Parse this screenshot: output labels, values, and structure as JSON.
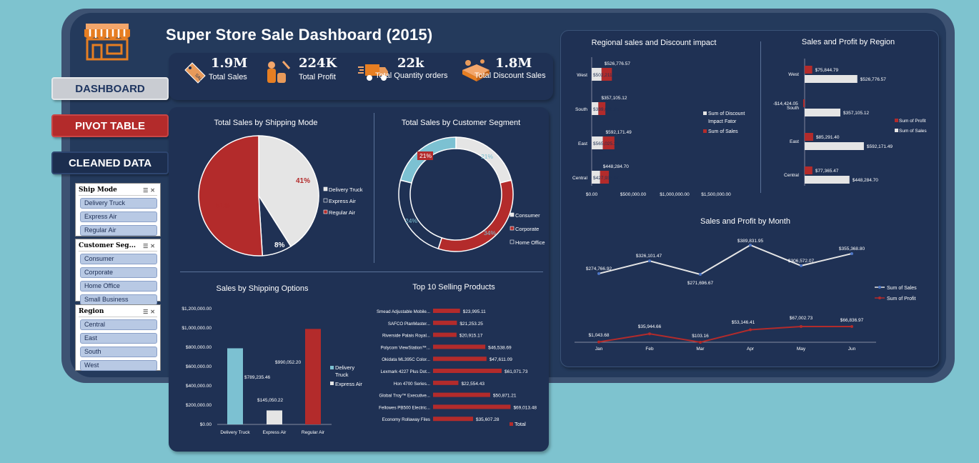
{
  "header": {
    "title": "Super Store Sale Dashboard (2015)"
  },
  "nav": {
    "dashboard": "DASHBOARD",
    "pivot": "PIVOT TABLE",
    "cleaned": "CLEANED DATA"
  },
  "kpis": [
    {
      "value": "1.9M",
      "label": "Total Sales",
      "icon": "sale-tag-icon"
    },
    {
      "value": "224K",
      "label": "Total Profit",
      "icon": "coins-icon"
    },
    {
      "value": "22k",
      "label": "Total Quantity orders",
      "icon": "truck-icon"
    },
    {
      "value": "1.8M",
      "label": "Total Discount Sales",
      "icon": "discount-box-icon"
    }
  ],
  "slicers": [
    {
      "title": "Ship Mode",
      "items": [
        "Delivery Truck",
        "Express Air",
        "Regular Air"
      ]
    },
    {
      "title": "Customer Seg...",
      "items": [
        "Consumer",
        "Corporate",
        "Home Office",
        "Small Business"
      ]
    },
    {
      "title": "Region",
      "items": [
        "Central",
        "East",
        "South",
        "West"
      ]
    }
  ],
  "colors": {
    "red": "#b32b2b",
    "grey": "#e5e5e5",
    "teal": "#7cc1d2",
    "navy": "#1f3154"
  },
  "chart_data": [
    {
      "id": "shipping_mode",
      "type": "pie",
      "title": "Total Sales by Shipping Mode",
      "categories": [
        "Delivery Truck",
        "Express Air",
        "Regular Air"
      ],
      "values": [
        41,
        8,
        51
      ],
      "labels": [
        "41%",
        "8%",
        "51%"
      ],
      "colors": [
        "#e5e5e5",
        "#1f3154",
        "#b32b2b"
      ]
    },
    {
      "id": "customer_segment",
      "type": "pie",
      "title": "Total Sales by Customer Segment",
      "categories": [
        "Consumer",
        "Corporate",
        "Home Office",
        "Small Business"
      ],
      "values": [
        21,
        34,
        24,
        21
      ],
      "labels": [
        "21%",
        "34%",
        "24%",
        "21%"
      ],
      "colors": [
        "#e5e5e5",
        "#b32b2b",
        "#1f3154",
        "#7cc1d2"
      ],
      "legend": [
        "Consumer",
        "Corporate",
        "Home Office"
      ]
    },
    {
      "id": "shipping_options",
      "type": "bar",
      "title": "Sales by Shipping Options",
      "categories": [
        "Delivery Truck",
        "Express Air",
        "Regular Air"
      ],
      "values": [
        789235.46,
        145050.22,
        990052.2
      ],
      "labels": [
        "$789,235.46",
        "$145,050.22",
        "$990,052.20"
      ],
      "colors": [
        "#7cc1d2",
        "#e5e5e5",
        "#b32b2b"
      ],
      "ylim": [
        0,
        1200000
      ],
      "yticks": [
        "$0.00",
        "$200,000.00",
        "$400,000.00",
        "$600,000.00",
        "$800,000.00",
        "$1,000,000.00",
        "$1,200,000.00"
      ],
      "legend": [
        "Delivery Truck",
        "Express Air"
      ]
    },
    {
      "id": "top_products",
      "type": "bar",
      "title": "Top 10 Selling Products",
      "categories": [
        "Smead Adjustable Mobile...",
        "SAFCO PlanMaster...",
        "Riverside Palais Royal...",
        "Polycom ViewStation™...",
        "Okidata ML395C Color...",
        "Lexmark 4227 Plus Dot...",
        "Hon 4700 Series...",
        "Global Troy™ Executive...",
        "Fellowes PB500 Electric...",
        "Economy Rollaway Files"
      ],
      "values": [
        23995.11,
        21253.25,
        20915.17,
        46538.69,
        47611.09,
        61071.73,
        22554.43,
        50871.21,
        69013.48,
        35607.28
      ],
      "labels": [
        "$23,995.11",
        "$21,253.25",
        "$20,915.17",
        "$46,538.69",
        "$47,611.09",
        "$61,071.73",
        "$22,554.43",
        "$50,871.21",
        "$69,013.48",
        "$35,607.28"
      ],
      "legend": [
        "Total"
      ]
    },
    {
      "id": "regional_discount",
      "type": "bar",
      "title": "Regional sales and Discount impact",
      "categories": [
        "West",
        "South",
        "East",
        "Central"
      ],
      "series": [
        {
          "name": "Sum of Discount Impact Fator",
          "values": [
            502211.83,
            339666.86,
            565025.23,
            427935.07
          ],
          "labels": [
            "$502,211.83",
            "$339,666.86",
            "$565,025.23",
            "$427,935.07"
          ]
        },
        {
          "name": "Sum of Sales",
          "values": [
            526776.57,
            357105.12,
            592171.49,
            448284.7
          ],
          "labels": [
            "$526,776.57",
            "$357,105.12",
            "$592,171.49",
            "$448,284.70"
          ]
        }
      ],
      "xticks": [
        "$0.00",
        "$500,000.00",
        "$1,000,000.00",
        "$1,500,000.00"
      ],
      "legend": [
        "Sum of Discount",
        "Impact Fator",
        "Sum of Sales"
      ]
    },
    {
      "id": "region_sales_profit",
      "type": "bar",
      "title": "Sales and Profit by Region",
      "categories": [
        "West",
        "South",
        "East",
        "Central"
      ],
      "series": [
        {
          "name": "Sum of Profit",
          "values": [
            75844.79,
            -14424.05,
            85291.4,
            77365.47
          ],
          "labels": [
            "$75,844.79",
            "-$14,424.05",
            "$85,291.40",
            "$77,365.47"
          ]
        },
        {
          "name": "Sum of Sales",
          "values": [
            526776.57,
            357105.12,
            592171.49,
            448284.7
          ],
          "labels": [
            "$526,776.57",
            "$357,105.12",
            "$592,171.49",
            "$448,284.70"
          ]
        }
      ]
    },
    {
      "id": "monthly",
      "type": "line",
      "title": "Sales and Profit by Month",
      "categories": [
        "Jan",
        "Feb",
        "Mar",
        "Apr",
        "May",
        "Jun"
      ],
      "series": [
        {
          "name": "Sum of Sales",
          "values": [
            274766.92,
            326101.47,
            271696.67,
            389831.95,
            306572.07,
            355368.8
          ],
          "labels": [
            "$274,766.92",
            "$326,101.47",
            "$271,696.67",
            "$389,831.95",
            "$306,572.07",
            "$355,368.80"
          ]
        },
        {
          "name": "Sum of Profit",
          "values": [
            1043.68,
            35944.66,
            103.16,
            53146.41,
            67002.73,
            66836.97
          ],
          "labels": [
            "$1,043.68",
            "$35,944.66",
            "$103.16",
            "$53,146.41",
            "$67,002.73",
            "$66,836.97"
          ]
        }
      ]
    }
  ]
}
